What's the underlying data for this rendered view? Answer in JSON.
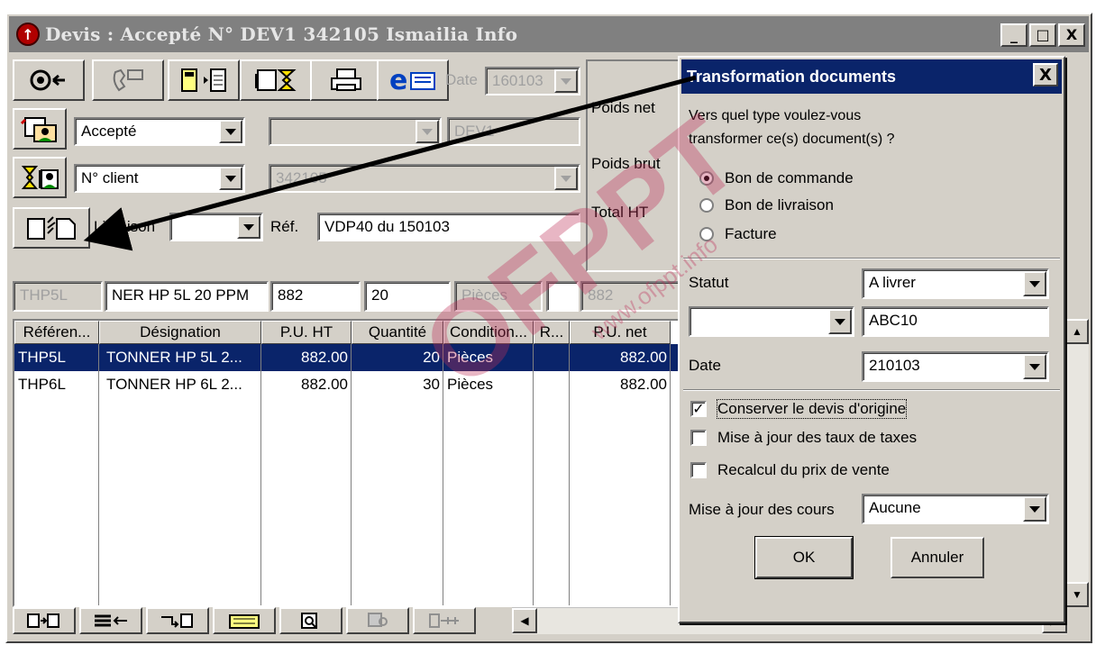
{
  "window": {
    "title": "Devis : Accepté N° DEV1 342105 Ismailia Info",
    "btn_min": "_",
    "btn_max": "□",
    "btn_close": "X"
  },
  "header": {
    "date_label": "Date",
    "date_value": "160103",
    "status_value": "Accepté",
    "code_value": "DEV1",
    "client_mode": "N° client",
    "client_value": "342105",
    "livraison_label": "Livraison",
    "ref_label": "Réf.",
    "ref_value": "VDP40 du 150103",
    "poids_net": "Poids net",
    "poids_brut": "Poids brut",
    "total_ht": "Total HT"
  },
  "entry_row": {
    "ref": "THP5L",
    "designation": "NER HP 5L  20 PPM",
    "pu": "882",
    "qty": "20",
    "cond": "Pièces",
    "net": "882"
  },
  "grid": {
    "headers": [
      "Référen...",
      "Désignation",
      "P.U. HT",
      "Quantité",
      "Condition...",
      "R...",
      "P.U. net"
    ],
    "rows": [
      [
        "THP5L",
        "TONNER HP 5L  2...",
        "882.00",
        "20",
        "Pièces",
        "",
        "882.00"
      ],
      [
        "THP6L",
        "TONNER HP 6L 2...",
        "882.00",
        "30",
        "Pièces",
        "",
        "882.00"
      ]
    ]
  },
  "dialog": {
    "title": "Transformation documents",
    "close": "X",
    "question_line1": "Vers quel type voulez-vous",
    "question_line2": "transformer ce(s) document(s) ?",
    "options": [
      "Bon de commande",
      "Bon de livraison",
      "Facture"
    ],
    "selected_option": "Bon de commande",
    "statut_label": "Statut",
    "statut_value": "A livrer",
    "code_value": "ABC10",
    "date_label": "Date",
    "date_value": "210103",
    "checks": [
      {
        "label": "Conserver le devis d'origine",
        "checked": true
      },
      {
        "label": "Mise à jour des taux de taxes",
        "checked": false
      },
      {
        "label": "Recalcul du prix de vente",
        "checked": false
      }
    ],
    "cours_label": "Mise à jour des cours",
    "cours_value": "Aucune",
    "ok": "OK",
    "cancel": "Annuler"
  },
  "watermark": {
    "text": "OFPPT",
    "url": "www.ofppt.info"
  },
  "colors": {
    "face": "#d4d0c8",
    "selection": "#0a246a",
    "inactive_title": "#808080",
    "watermark": "#c0305a"
  }
}
